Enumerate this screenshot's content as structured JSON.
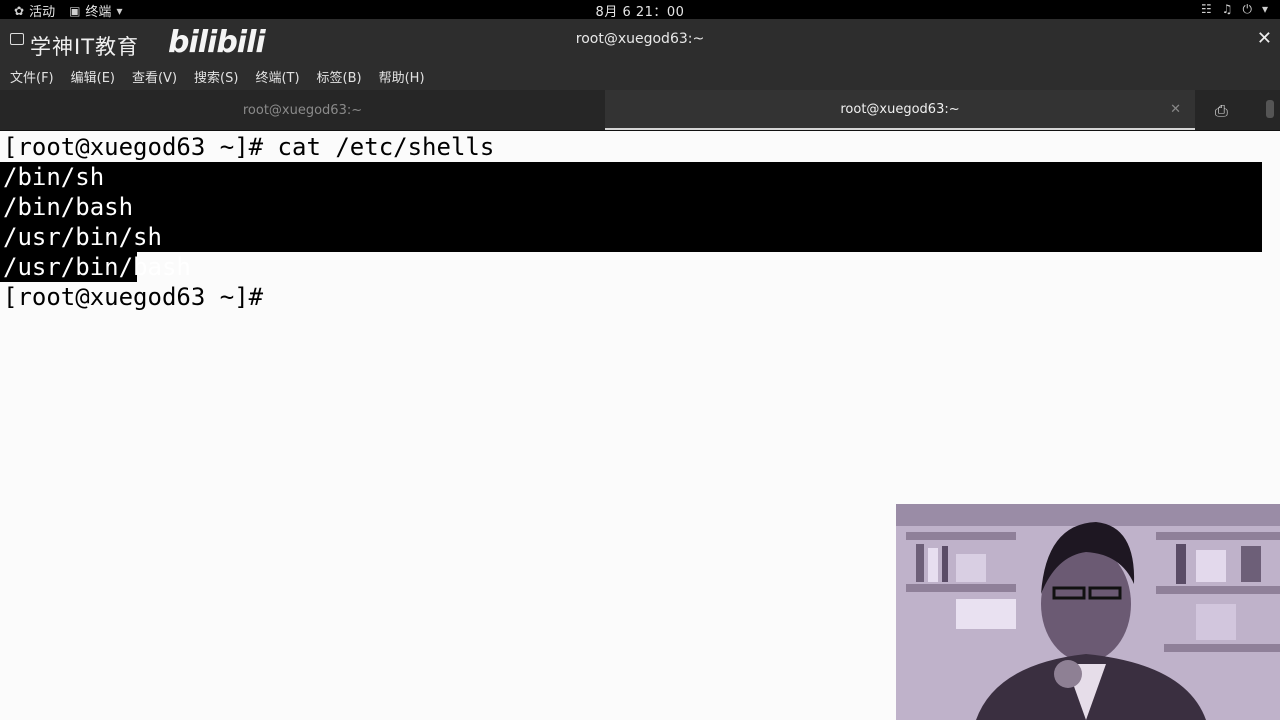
{
  "topbar": {
    "activities_label": "活动",
    "app_label": "终端",
    "clock": "8月 6  21：00"
  },
  "window": {
    "brand_text": "学神IT教育",
    "brand_logo": "bilibili",
    "title": "root@xuegod63:~"
  },
  "menu": {
    "items": [
      "文件(F)",
      "编辑(E)",
      "查看(V)",
      "搜索(S)",
      "终端(T)",
      "标签(B)",
      "帮助(H)"
    ]
  },
  "tabs": [
    {
      "label": "root@xuegod63:~",
      "active": false
    },
    {
      "label": "root@xuegod63:~",
      "active": true
    }
  ],
  "terminal": {
    "prompt": "[root@xuegod63 ~]#",
    "command": "cat /etc/shells",
    "output": [
      "/bin/sh",
      "/bin/bash",
      "/usr/bin/sh",
      "/usr/bin/bash"
    ],
    "final_prompt": "[root@xuegod63 ~]#"
  },
  "colors": {
    "terminal_bg": "#fbfbfb",
    "selection": "#000000",
    "chrome_bg": "#2d2d2d"
  }
}
